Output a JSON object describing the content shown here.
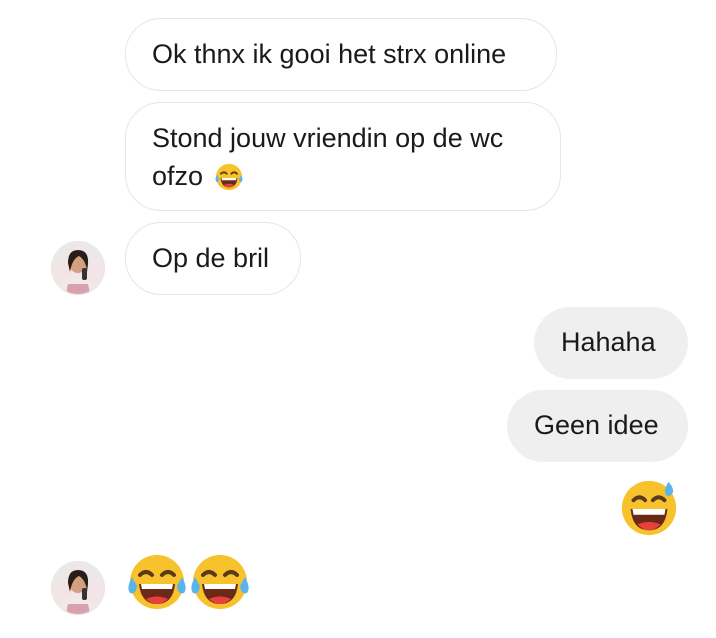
{
  "messages": [
    {
      "text": "Ok thnx ik gooi het strx online",
      "direction": "incoming"
    },
    {
      "text": "Stond jouw vriendin op de wc ofzo",
      "trailing_emoji": "face-with-tears-of-joy",
      "direction": "incoming"
    },
    {
      "text": "Op de bril",
      "direction": "incoming"
    },
    {
      "text": "Hahaha",
      "direction": "outgoing"
    },
    {
      "text": "Geen idee",
      "direction": "outgoing"
    },
    {
      "emoji": "grinning-face-with-sweat",
      "direction": "outgoing"
    },
    {
      "emojis": [
        "face-with-tears-of-joy",
        "face-with-tears-of-joy"
      ],
      "direction": "incoming"
    }
  ],
  "colors": {
    "incoming_bubble_bg": "#ffffff",
    "incoming_bubble_border": "#e6e6e6",
    "outgoing_bubble_bg": "#efefef",
    "text": "#1a1a1a",
    "emoji_yellow": "#f7c22b"
  }
}
